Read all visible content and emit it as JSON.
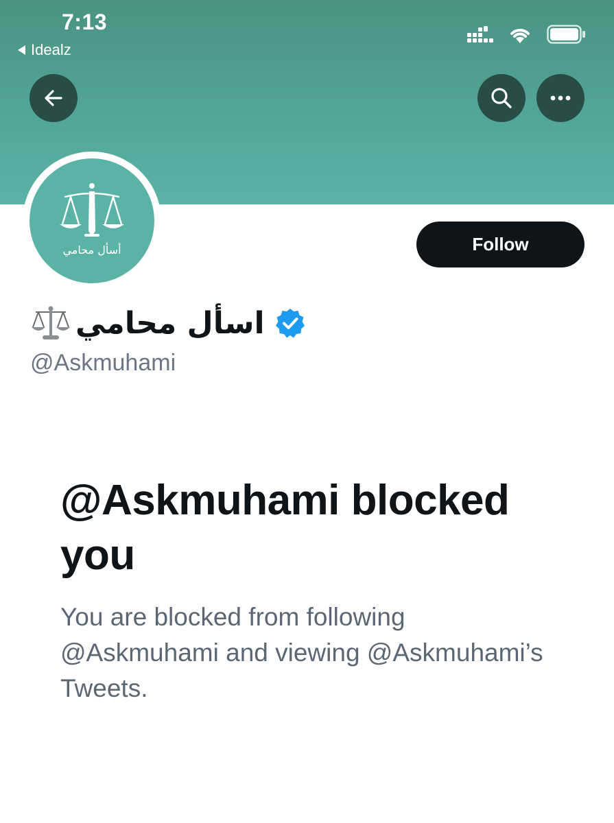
{
  "status_bar": {
    "time": "7:13",
    "back_app": "Idealz",
    "icons": [
      "cellular-signal-icon",
      "wifi-icon",
      "battery-icon"
    ]
  },
  "header": {
    "back_icon": "back-arrow-icon",
    "search_icon": "search-icon",
    "more_icon": "more-options-icon",
    "banner_color": "#52a597"
  },
  "profile": {
    "avatar_caption": "أسأل محامي",
    "display_name": "اسأل محامي",
    "name_emoji": "⚖️",
    "verified": true,
    "verified_color": "#1d9bf0",
    "handle": "@Askmuhami",
    "follow_label": "Follow"
  },
  "blocked": {
    "title": "@Askmuhami blocked you",
    "description": "You are blocked from following @Askmuhami and viewing @Askmuhami’s Tweets."
  }
}
